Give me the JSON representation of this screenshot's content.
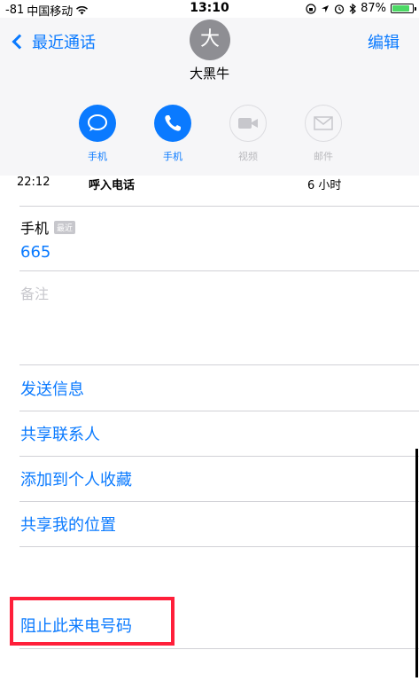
{
  "status_bar": {
    "signal": "-81",
    "carrier": "中国移动",
    "time": "13:10",
    "battery": "87%",
    "battery_level": 0.87
  },
  "nav": {
    "back_label": "最近通话",
    "edit_label": "编辑"
  },
  "contact": {
    "avatar_letter": "大",
    "name": "大黑牛"
  },
  "actions": [
    {
      "label": "手机",
      "icon": "message-icon",
      "enabled": true
    },
    {
      "label": "手机",
      "icon": "phone-icon",
      "enabled": true
    },
    {
      "label": "视频",
      "icon": "video-icon",
      "enabled": false
    },
    {
      "label": "邮件",
      "icon": "mail-icon",
      "enabled": false
    }
  ],
  "call_info": {
    "time": "22:12",
    "type": "呼入电话",
    "duration": "6 小时"
  },
  "phone": {
    "label": "手机",
    "badge": "最近",
    "number": "665"
  },
  "notes": {
    "label": "备注"
  },
  "menu": {
    "send_message": "发送信息",
    "share_contact": "共享联系人",
    "add_favorite": "添加到个人收藏",
    "share_location": "共享我的位置",
    "block_caller": "阻止此来电号码"
  },
  "colors": {
    "accent": "#0a7aff",
    "highlight": "#ff1f3a",
    "battery": "#4cd964"
  }
}
